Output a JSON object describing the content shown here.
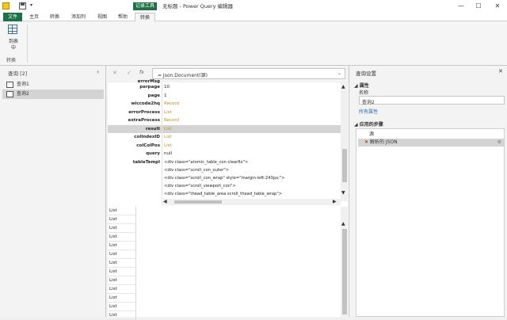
{
  "titlebar": {
    "contextual_tab": "记录工具",
    "title": "无标题 - Power Query 编辑器",
    "qat_undo": "⮌"
  },
  "ribbon_tabs": [
    {
      "label": "文件"
    },
    {
      "label": "主页"
    },
    {
      "label": "转换"
    },
    {
      "label": "添加列"
    },
    {
      "label": "视图"
    },
    {
      "label": "帮助"
    },
    {
      "label": "转换"
    }
  ],
  "ribbon": {
    "into_table_label_line1": "到表",
    "into_table_label_line2": "中",
    "group_label": "转换"
  },
  "left_pane": {
    "header": "查询 [2]",
    "queries": [
      {
        "label": "查询1"
      },
      {
        "label": "查询2"
      }
    ]
  },
  "formula_bar": {
    "cancel_glyph": "✕",
    "commit_glyph": "✓",
    "fx_glyph": "fx",
    "formula": "= Json.Document(源)"
  },
  "record": {
    "partial_top_key": "errorMsg",
    "rows": [
      {
        "key": "perpage",
        "value": "10",
        "kind": "plain"
      },
      {
        "key": "page",
        "value": "1",
        "kind": "plain"
      },
      {
        "key": "wiccode2hq",
        "value": "Record",
        "kind": "link"
      },
      {
        "key": "errorProcess",
        "value": "List",
        "kind": "link"
      },
      {
        "key": "extraProcess",
        "value": "Record",
        "kind": "link"
      },
      {
        "key": "result",
        "value": "List",
        "kind": "link",
        "selected": true
      },
      {
        "key": "colIndexID",
        "value": "List",
        "kind": "link"
      },
      {
        "key": "colColPos",
        "value": "List",
        "kind": "link"
      },
      {
        "key": "query",
        "value": "null",
        "kind": "plain"
      }
    ],
    "template_key": "tableTempl",
    "template_lines": [
      "<div class=\"atomic_table_con clearfix\">",
      "<div class=\"scroll_con_outer\">",
      "<div class=\"scroll_con_wrap\" style=\"margin-left:243px;\">",
      "<div class=\"scroll_viewport_con\">",
      "<div class=\"thead_table_area scroll_thead_table_wrap\">"
    ]
  },
  "lower_grid": {
    "cells": [
      "List",
      "List",
      "List",
      "List",
      "List",
      "List",
      "List",
      "List",
      "List",
      "List",
      "List",
      "List",
      "List",
      "List",
      "List"
    ]
  },
  "right_pane": {
    "header": "查询设置",
    "close_glyph": "✕",
    "properties_title": "属性",
    "name_label": "名称",
    "name_value": "查询2",
    "all_properties_link": "所有属性",
    "applied_steps_title": "应用的步骤",
    "steps": [
      {
        "label": "源"
      },
      {
        "label": "解析的 JSON"
      }
    ]
  },
  "colors": {
    "accent_green": "#1e7145",
    "link_orange": "#c78a1e",
    "link_blue": "#2b6cb0"
  }
}
